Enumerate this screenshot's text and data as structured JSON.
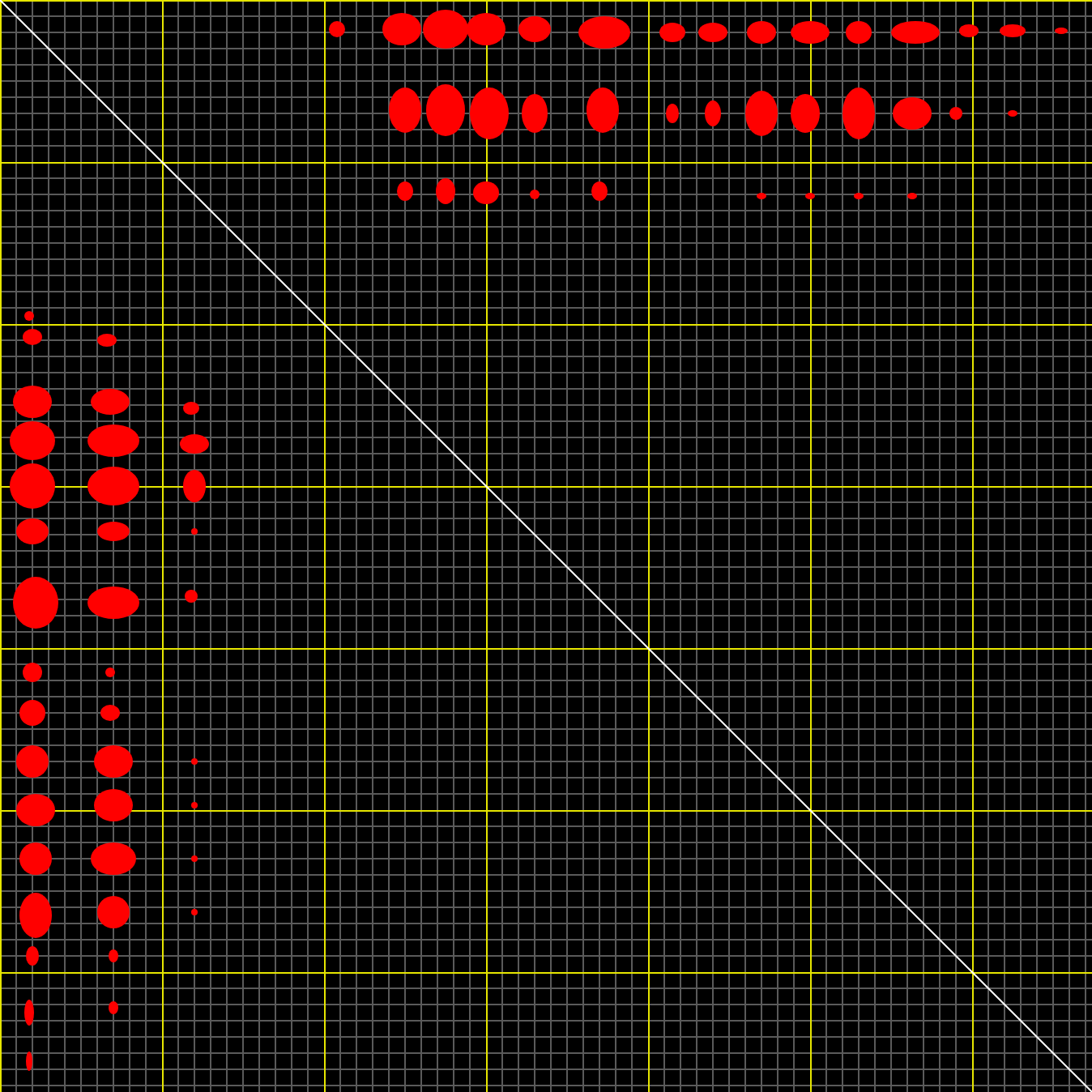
{
  "plot": {
    "kind": "contact-map"
  }
}
